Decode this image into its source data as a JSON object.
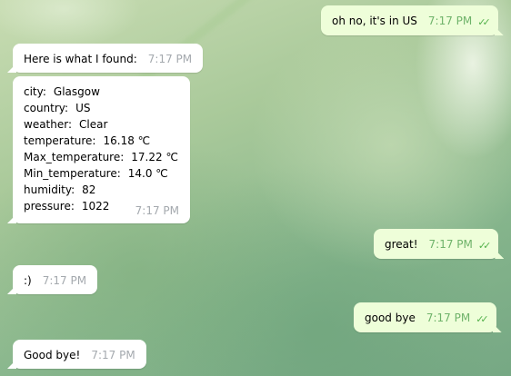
{
  "messages": {
    "m1": {
      "text": "oh no, it's in US",
      "time": "7:17 PM"
    },
    "m2": {
      "text": "Here is what I found:",
      "time": "7:17 PM"
    },
    "m3": {
      "time": "7:17 PM",
      "fields": [
        {
          "key": "city:",
          "value": "Glasgow"
        },
        {
          "key": "country:",
          "value": "US"
        },
        {
          "key": "weather:",
          "value": "Clear"
        },
        {
          "key": "temperature:",
          "value": "16.18 ℃"
        },
        {
          "key": "Max_temperature:",
          "value": "17.22 ℃"
        },
        {
          "key": "Min_temperature:",
          "value": "14.0 ℃"
        },
        {
          "key": "humidity:",
          "value": "82"
        },
        {
          "key": "pressure:",
          "value": "1022"
        }
      ]
    },
    "m4": {
      "text": "great!",
      "time": "7:17 PM"
    },
    "m5": {
      "text": ":)",
      "time": "7:17 PM"
    },
    "m6": {
      "text": "good bye",
      "time": "7:17 PM"
    },
    "m7": {
      "text": "Good bye!",
      "time": "7:17 PM"
    }
  },
  "icons": {
    "read_receipt": "double-check-icon"
  },
  "colors": {
    "incoming_bubble": "#ffffff",
    "outgoing_bubble": "#eefed9",
    "outgoing_time": "#6fb36a",
    "checks": "#55b24d",
    "incoming_time": "#a4a9ae"
  }
}
